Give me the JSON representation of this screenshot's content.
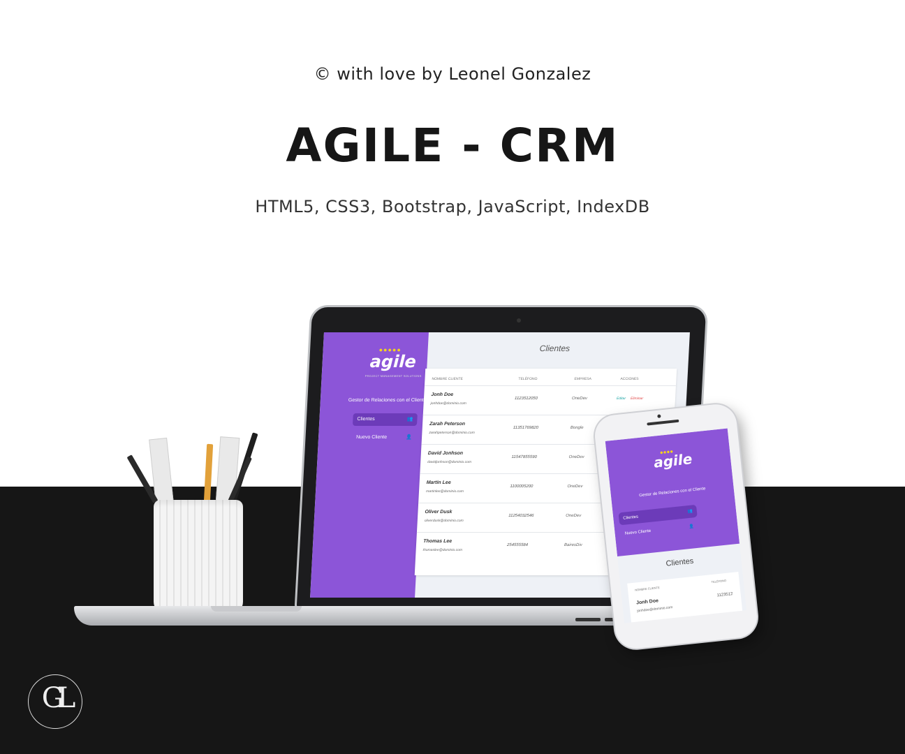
{
  "header": {
    "credit": "© with love by Leonel Gonzalez",
    "title": "AGILE - CRM",
    "technologies": "HTML5, CSS3, Bootstrap, JavaScript, IndexDB"
  },
  "app": {
    "logo": "agile",
    "logo_tagline": "PROJECT MANAGEMENT SOLUTIONS",
    "description": "Gestor de Relaciones con el Cliente",
    "nav": [
      {
        "label": "Clientes",
        "active": true
      },
      {
        "label": "Nuevo Cliente",
        "active": false
      }
    ],
    "page_title": "Clientes",
    "columns": [
      "NOMBRE CLIENTE",
      "TELÉFONO",
      "EMPRESA",
      "ACCIONES"
    ],
    "actions": {
      "edit": "Editar",
      "delete": "Eliminar"
    },
    "clients": [
      {
        "name": "Jonh Doe",
        "email": "jonhdoe@dominio.com",
        "phone": "1123512050",
        "company": "OneDev"
      },
      {
        "name": "Zarah Peterson",
        "email": "zarahpeterson@dominio.com",
        "phone": "11351769820",
        "company": "Bongle"
      },
      {
        "name": "David Jonhson",
        "email": "davidjonhson@dominio.com",
        "phone": "11547855590",
        "company": "OneDev"
      },
      {
        "name": "Martin Lee",
        "email": "martinlee@dominio.com",
        "phone": "1100005200",
        "company": "OneDev"
      },
      {
        "name": "Oliver Dusk",
        "email": "oliverdusk@dominio.com",
        "phone": "11254032546",
        "company": "OneDev"
      },
      {
        "name": "Thomas Lee",
        "email": "thomaslee@dominio.com",
        "phone": "254555584",
        "company": "BairesDiv"
      }
    ]
  },
  "phone": {
    "logo": "agile",
    "description": "Gestor de Relaciones con el Cliente",
    "nav": [
      {
        "label": "Clientes",
        "active": true
      },
      {
        "label": "Nuevo Cliente",
        "active": false
      }
    ],
    "page_title": "Clientes",
    "columns": [
      "NOMBRE CLIENTE",
      "TELÉFONO"
    ],
    "client": {
      "name": "Jonh Doe",
      "email": "jonhdoe@dominio.com",
      "phone": "1123512"
    }
  },
  "signature": "GL",
  "colors": {
    "accent": "#8c55d8",
    "logo_dots": "#f5d31e",
    "edit": "#1aa3a3",
    "delete": "#e04444",
    "band": "#161616"
  }
}
